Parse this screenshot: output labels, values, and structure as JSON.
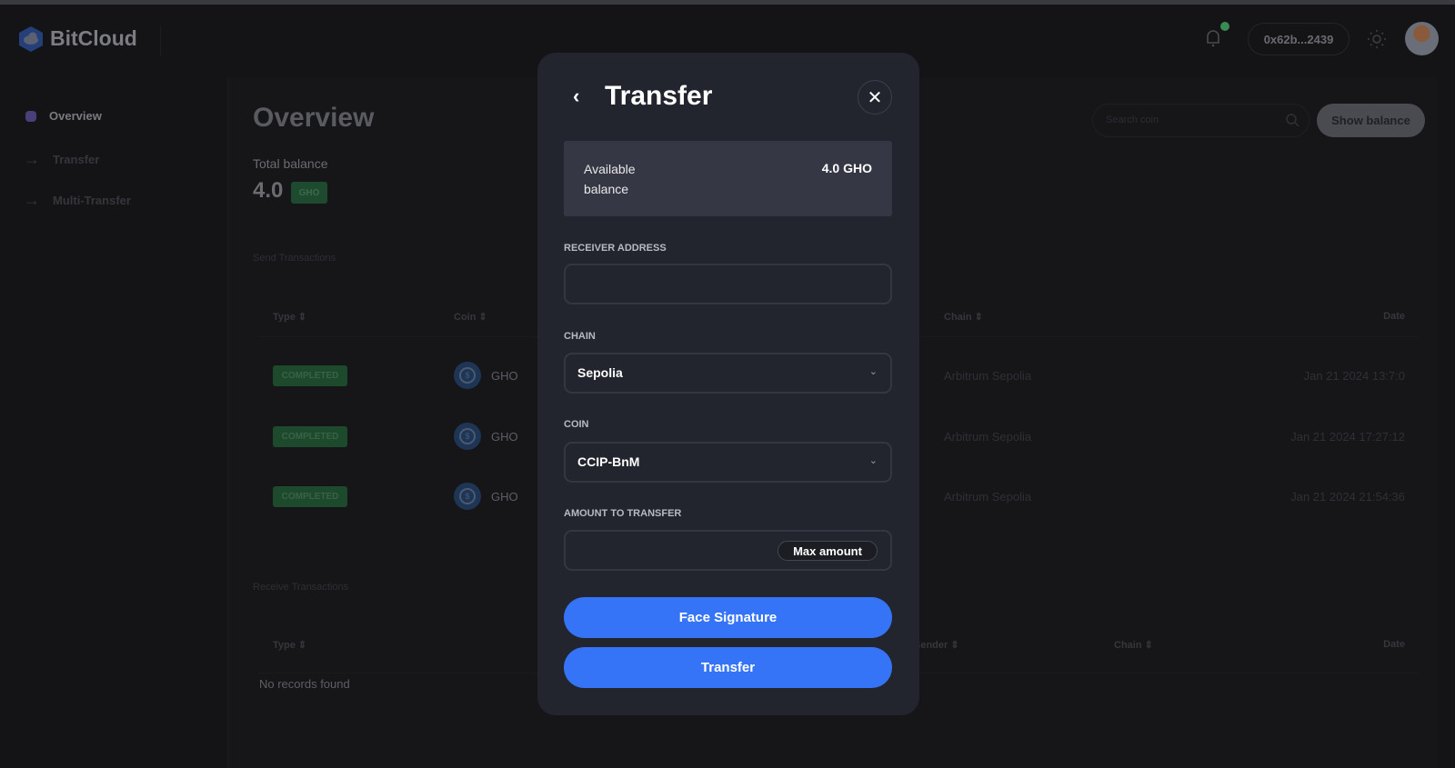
{
  "header": {
    "brand": "BitCloud",
    "wallet_address": "0x62b...2439",
    "notification_dot_color": "#3a8a55"
  },
  "sidebar": {
    "items": [
      {
        "label": "Overview",
        "icon": "dot-icon",
        "active": true
      },
      {
        "label": "Transfer",
        "icon": "arrow-right-icon"
      },
      {
        "label": "Multi-Transfer",
        "icon": "arrow-right-icon"
      }
    ]
  },
  "main": {
    "title": "Overview",
    "total_balance_label": "Total balance",
    "total_balance_value": "4.0",
    "total_balance_unit": "GHO",
    "search_placeholder": "Search coin",
    "show_balance_label": "Show balance",
    "send": {
      "title": "Send Transactions",
      "columns": [
        "Type",
        "Coin",
        "Chain",
        "Date"
      ],
      "rows": [
        {
          "type": "COMPLETED",
          "coin": "GHO",
          "chain": "Arbitrum Sepolia",
          "date": "Jan 21 2024 13:7:0"
        },
        {
          "type": "COMPLETED",
          "coin": "GHO",
          "chain": "Arbitrum Sepolia",
          "date": "Jan 21 2024 17:27:12"
        },
        {
          "type": "COMPLETED",
          "coin": "GHO",
          "chain": "Arbitrum Sepolia",
          "date": "Jan 21 2024 21:54:36"
        }
      ]
    },
    "receive": {
      "title": "Receive Transactions",
      "columns": [
        "Type",
        "Sender",
        "Chain",
        "Date"
      ],
      "empty": "No records found"
    }
  },
  "modal": {
    "title": "Transfer",
    "available_label": "Available balance",
    "available_value": "4.0 GHO",
    "receiver_label": "RECEIVER ADDRESS",
    "receiver_value": "",
    "chain_label": "CHAIN",
    "chain_value": "Sepolia",
    "coin_label": "COIN",
    "coin_value": "CCIP-BnM",
    "amount_label": "AMOUNT TO TRANSFER",
    "amount_value": "",
    "max_label": "Max amount",
    "face_signature_label": "Face Signature",
    "transfer_label": "Transfer",
    "accent": "#3574f7"
  }
}
